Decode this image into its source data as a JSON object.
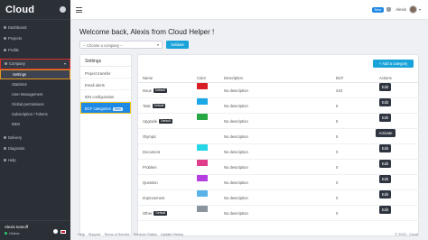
{
  "brand": {
    "name": "Cloud"
  },
  "sidebar": {
    "items": [
      {
        "label": "Dashboard",
        "type": "item"
      },
      {
        "label": "Projects",
        "type": "item"
      },
      {
        "label": "Profile",
        "type": "item"
      },
      {
        "label": "Company",
        "type": "group-open"
      },
      {
        "label": "Settings",
        "type": "sub-active"
      },
      {
        "label": "Statistics",
        "type": "sub"
      },
      {
        "label": "User Management",
        "type": "sub"
      },
      {
        "label": "Global permissions",
        "type": "sub"
      },
      {
        "label": "Subscription / Tokens",
        "type": "sub"
      },
      {
        "label": "BIDs",
        "type": "sub"
      },
      {
        "label": "Delivery",
        "type": "item"
      },
      {
        "label": "Diagnosis",
        "type": "item"
      },
      {
        "label": "Help",
        "type": "item"
      }
    ],
    "user": {
      "name": "Alexis Ivanoff",
      "status": "Online"
    }
  },
  "topbar": {
    "badge": "New",
    "user_name": "Alexis",
    "caret": "▾"
  },
  "main": {
    "welcome": "Welcome back, Alexis from Cloud Helper !",
    "company_select": {
      "value": "-- Choose a company --"
    },
    "validate_label": "Validate"
  },
  "settings_card": {
    "title": "Settings",
    "items": [
      {
        "label": "Project transfer"
      },
      {
        "label": "Email alerts"
      },
      {
        "label": "IDN configuration"
      },
      {
        "label": "BCF categories",
        "tag": "New"
      }
    ]
  },
  "table": {
    "add_label": "+ Add a category",
    "headers": [
      "Name",
      "Color",
      "Description",
      "BCF",
      "Actions"
    ],
    "default_tag": "Default",
    "rows": [
      {
        "name": "Issue",
        "default": true,
        "color": "#d81f26",
        "description": "No description",
        "bcf": "243",
        "action": "Edit"
      },
      {
        "name": "Task",
        "default": true,
        "color": "#1aa8e6",
        "description": "No description",
        "bcf": "6",
        "action": "Edit"
      },
      {
        "name": "Upgrade",
        "default": true,
        "color": "#27a844",
        "description": "No description",
        "bcf": "5",
        "action": "Edit"
      },
      {
        "name": "Olympic",
        "default": false,
        "color": "",
        "description": "No description",
        "bcf": "5",
        "action": "Activate"
      },
      {
        "name": "Document",
        "default": false,
        "color": "#24d6e6",
        "description": "No description",
        "bcf": "0",
        "action": "Edit"
      },
      {
        "name": "Problem",
        "default": false,
        "color": "#e03d8a",
        "description": "No description",
        "bcf": "0",
        "action": "Edit"
      },
      {
        "name": "Question",
        "default": false,
        "color": "#b43ee0",
        "description": "No description",
        "bcf": "0",
        "action": "Edit"
      },
      {
        "name": "Improvement",
        "default": false,
        "color": "#5ab2e8",
        "description": "No description",
        "bcf": "0",
        "action": "Edit"
      },
      {
        "name": "Other",
        "default": true,
        "color": "#8b949d",
        "description": "No description",
        "bcf": "0",
        "action": "Edit"
      }
    ]
  },
  "footer": {
    "links": [
      "Help",
      "Support",
      "Terms of Service",
      "Services Status",
      "Update History"
    ],
    "copyright": "© 2023 - Cloud"
  }
}
